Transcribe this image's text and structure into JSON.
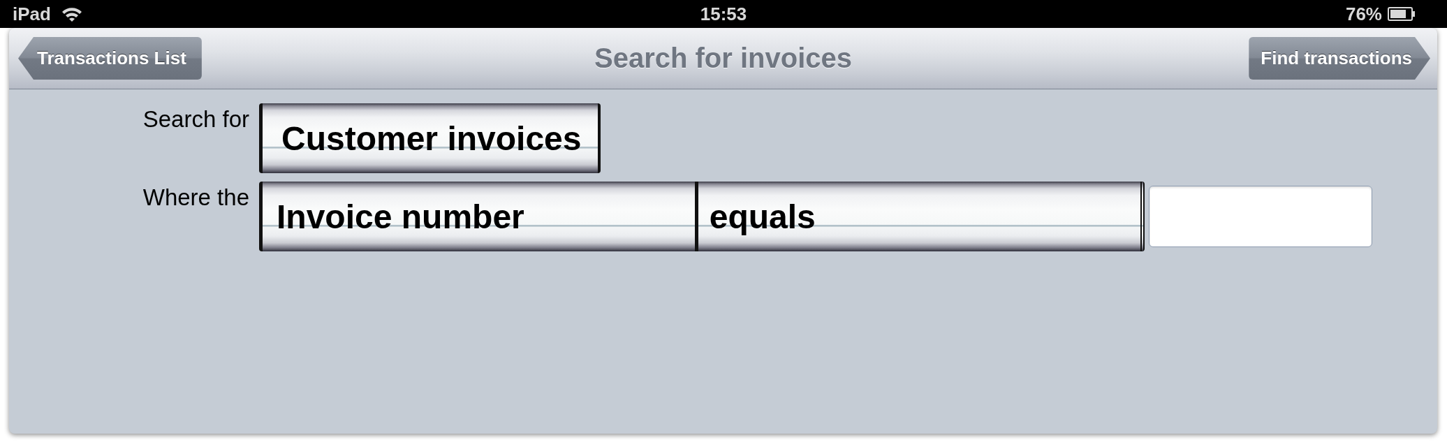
{
  "status_bar": {
    "device": "iPad",
    "time": "15:53",
    "battery": "76%"
  },
  "nav_bar": {
    "back_button": "Transactions List",
    "title": "Search for invoices",
    "forward_button": "Find transactions"
  },
  "form": {
    "rows": [
      {
        "label": "Search for",
        "picker": [
          {
            "value": "Customer invoices"
          }
        ],
        "text_field": false
      },
      {
        "label": "Where the",
        "picker": [
          {
            "value": "Invoice number"
          },
          {
            "value": "equals"
          }
        ],
        "text_field": true
      }
    ]
  }
}
